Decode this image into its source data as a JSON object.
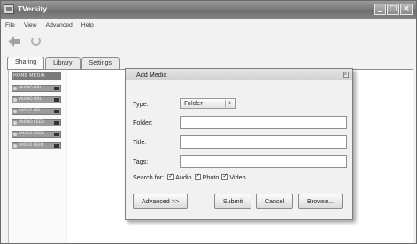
{
  "window": {
    "title": "TVersity",
    "controls": {
      "minimize": "_",
      "maximize": "□",
      "close": "×"
    }
  },
  "menu": [
    "File",
    "View",
    "Advanced",
    "Help"
  ],
  "toolbar": {
    "icons": [
      "back-arrow-icon",
      "refresh-icon"
    ]
  },
  "tabs": [
    {
      "label": "Sharing",
      "active": true
    },
    {
      "label": "Library",
      "active": false
    },
    {
      "label": "Settings",
      "active": false
    }
  ],
  "sidebar": {
    "header": "HOME  MEDIA",
    "items": [
      "AUDIO URL",
      "AUDIO URL",
      "VIDEO URL",
      "AUDIO FEED",
      "IMAGE FEED",
      "VIDEO FEED"
    ]
  },
  "dialog": {
    "title": "Add Media",
    "close_label": "x",
    "type_label": "Type:",
    "type_value": "Folder",
    "folder_label": "Folder:",
    "folder_value": "",
    "title_label": "Title:",
    "title_value": "",
    "tags_label": "Tags:",
    "tags_value": "",
    "search_for_label": "Search for:",
    "search_options": [
      {
        "label": "Audio",
        "checked": true
      },
      {
        "label": "Photo",
        "checked": true
      },
      {
        "label": "Video",
        "checked": true
      }
    ],
    "buttons": {
      "advanced": "Advanced >>",
      "submit": "Submit",
      "cancel": "Cancel",
      "browse": "Browse..."
    }
  }
}
